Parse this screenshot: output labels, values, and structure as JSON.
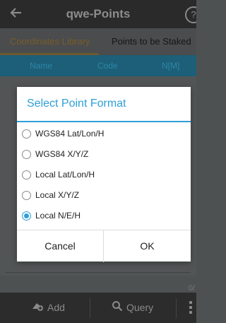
{
  "header": {
    "title": "qwe-Points",
    "back_icon": "arrow-left-icon",
    "help_icon": "help-circle-icon",
    "help_glyph": "?"
  },
  "tabs": [
    {
      "label": "Coordinates Library",
      "selected": true
    },
    {
      "label": "Points to be Staked",
      "selected": false
    }
  ],
  "table": {
    "columns": [
      "Name",
      "Code",
      "N[M]"
    ]
  },
  "list": {
    "count_text": "0/"
  },
  "bottom_bar": {
    "add_label": "Add",
    "add_icon": "add-point-icon",
    "query_label": "Query",
    "query_icon": "search-icon",
    "more_icon": "more-vertical-icon"
  },
  "dialog": {
    "title": "Select Point Format",
    "options": [
      {
        "label": "WGS84 Lat/Lon/H",
        "selected": false
      },
      {
        "label": "WGS84 X/Y/Z",
        "selected": false
      },
      {
        "label": "Local Lat/Lon/H",
        "selected": false
      },
      {
        "label": "Local X/Y/Z",
        "selected": false
      },
      {
        "label": "Local N/E/H",
        "selected": true
      }
    ],
    "cancel_label": "Cancel",
    "ok_label": "OK"
  },
  "colors": {
    "accent": "#2e9fd6",
    "table_header": "#1d5f78",
    "titlebar": "#2a2a2a",
    "overlay_bg": "#525556"
  }
}
